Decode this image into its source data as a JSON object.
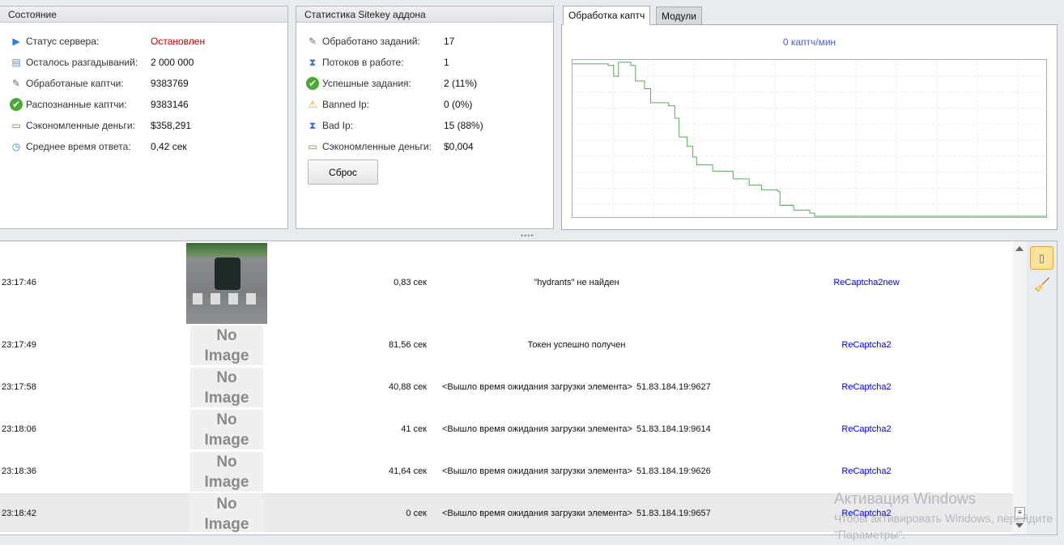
{
  "status_panel": {
    "title": "Состояние",
    "items": [
      {
        "icon": "play-circle-icon",
        "label": "Статус сервера:",
        "value": "Остановлен",
        "value_color": "#cc0000"
      },
      {
        "icon": "document-lightning-icon",
        "label": "Осталось разгадываний:",
        "value": "2 000 000"
      },
      {
        "icon": "edit-document-icon",
        "label": "Обработаные каптчи:",
        "value": "9383769"
      },
      {
        "icon": "check-circle-icon",
        "label": "Распознанные каптчи:",
        "value": "9383146"
      },
      {
        "icon": "money-icon",
        "label": "Сэкономленные деньги:",
        "value": "$358,291"
      },
      {
        "icon": "clock-icon",
        "label": "Среднее время ответа:",
        "value": "0,42 сек"
      }
    ]
  },
  "sitekey_panel": {
    "title": "Статистика Sitekey аддона",
    "items": [
      {
        "icon": "edit-document-icon",
        "label": "Обработано заданий:",
        "value": "17"
      },
      {
        "icon": "hourglass-icon",
        "label": "Потоков в работе:",
        "value": "1"
      },
      {
        "icon": "check-circle-icon",
        "label": "Успешные задания:",
        "value": "2 (11%)"
      },
      {
        "icon": "warning-icon",
        "label": "Banned Ip:",
        "value": "0 (0%)"
      },
      {
        "icon": "hourglass-icon",
        "label": "Bad Ip:",
        "value": "15 (88%)"
      },
      {
        "icon": "money-icon",
        "label": "Сэкономленные деньги:",
        "value": "$0,004"
      }
    ],
    "reset_label": "Сброс"
  },
  "tabs": [
    {
      "label": "Обработка каптч",
      "active": true
    },
    {
      "label": "Модули",
      "active": false
    }
  ],
  "chart_data": {
    "type": "line",
    "title": "0 каптч/мин",
    "xlim": [
      0,
      100
    ],
    "ylim": [
      0,
      100
    ],
    "grid": true,
    "color": "#5aac5a",
    "x": [
      0,
      7.5,
      8.7,
      9.5,
      9.7,
      10.7,
      12.3,
      13.3,
      15.2,
      16.5,
      20.3,
      21.6,
      22.5,
      24.2,
      25.4,
      26.2,
      29.6,
      33.9,
      37.3,
      39.9,
      43.3,
      43.8,
      46.7,
      50.1,
      51.1,
      100
    ],
    "y": [
      98,
      97,
      90,
      90,
      99,
      99,
      97,
      87,
      82,
      73,
      71,
      63,
      51,
      45,
      38,
      33,
      29,
      24,
      20,
      17,
      16,
      7,
      4,
      2,
      0,
      0
    ]
  },
  "log": [
    {
      "time": "23:17:46",
      "image": "photo",
      "duration": "0,83 сек",
      "message": "\"hydrants\" не найден",
      "ip": "",
      "type": "ReCaptcha2new"
    },
    {
      "time": "23:17:49",
      "image": "none",
      "duration": "81,56 сек",
      "message": "Токен успешно получен",
      "ip": "",
      "type": "ReCaptcha2"
    },
    {
      "time": "23:17:58",
      "image": "none",
      "duration": "40,88 сек",
      "message": "<Вышло время ожидания загрузки элемента>",
      "ip": "51.83.184.19:9627",
      "type": "ReCaptcha2"
    },
    {
      "time": "23:18:06",
      "image": "none",
      "duration": "41 сек",
      "message": "<Вышло время ожидания загрузки элемента>",
      "ip": "51.83.184.19:9614",
      "type": "ReCaptcha2"
    },
    {
      "time": "23:18:36",
      "image": "none",
      "duration": "41,64 сек",
      "message": "<Вышло время ожидания загрузки элемента>",
      "ip": "51.83.184.19:9626",
      "type": "ReCaptcha2"
    },
    {
      "time": "23:18:42",
      "image": "none",
      "duration": "0 сек",
      "message": "<Вышло время ожидания загрузки элемента>",
      "ip": "51.83.184.19:9657",
      "type": "ReCaptcha2",
      "selected": true
    }
  ],
  "no_image": [
    "No",
    "Image"
  ],
  "watermark": {
    "title": "Активация Windows",
    "line1": "Чтобы активировать Windows, перейдите",
    "line2": "\"Параметры\"."
  }
}
